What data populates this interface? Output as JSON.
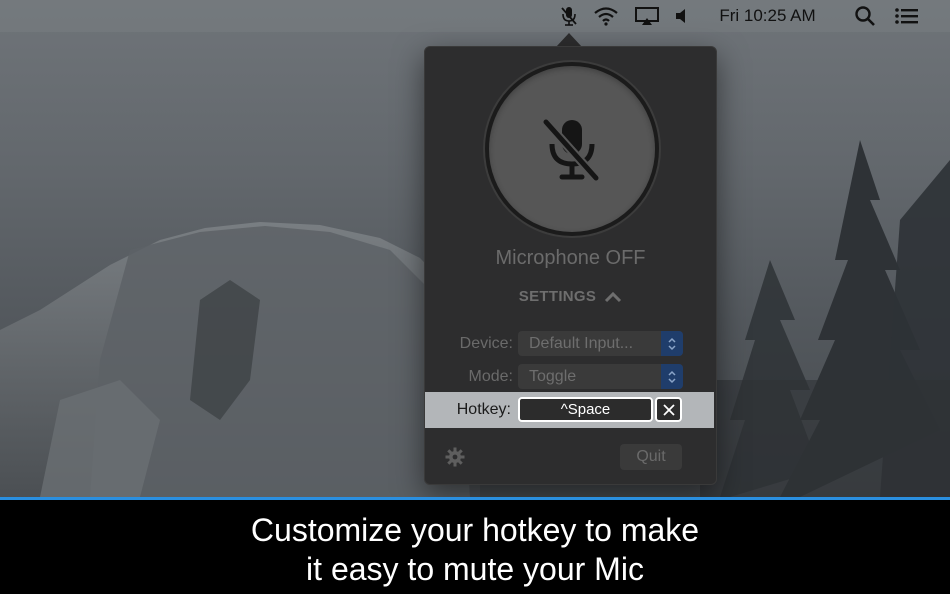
{
  "menubar": {
    "clock": "Fri 10:25 AM",
    "icons": [
      "microphone-muted-icon",
      "wifi-icon",
      "airplay-icon",
      "volume-icon",
      "spotlight-search-icon",
      "notification-center-icon"
    ]
  },
  "popover": {
    "status": "Microphone OFF",
    "settings_label": "SETTINGS",
    "device": {
      "label": "Device:",
      "value": "Default Input..."
    },
    "mode": {
      "label": "Mode:",
      "value": "Toggle"
    },
    "hotkey": {
      "label": "Hotkey:",
      "value": "^Space"
    },
    "quit_label": "Quit"
  },
  "caption": {
    "line1": "Customize your hotkey to make",
    "line2": "it easy to mute your Mic"
  },
  "colors": {
    "accent_blue": "#2a8fe0",
    "stepper_blue": "#1f3d6b",
    "popover_bg": "#2d2d2e"
  }
}
